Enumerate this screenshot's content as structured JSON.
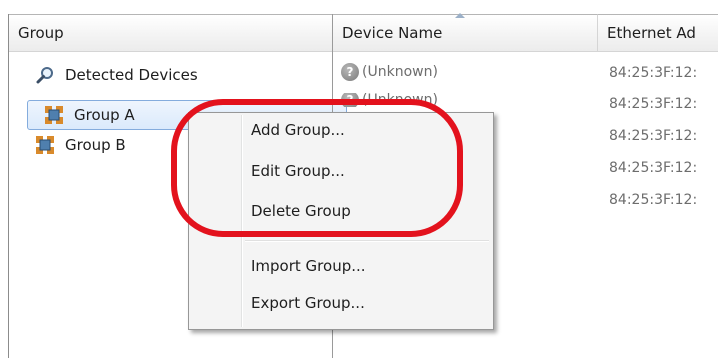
{
  "left_pane": {
    "header": "Group",
    "items": [
      {
        "label": "Detected Devices",
        "icon": "magnifier-icon"
      },
      {
        "label": "Group A",
        "icon": "group-icon",
        "selected": true
      },
      {
        "label": "Group B",
        "icon": "group-icon"
      }
    ]
  },
  "right_pane": {
    "columns": [
      "Device Name",
      "Ethernet Ad"
    ],
    "rows": [
      {
        "name": "(Unknown)",
        "ethernet": "84:25:3F:12:"
      },
      {
        "name": "(Unknown)",
        "ethernet": "84:25:3F:12:"
      },
      {
        "name": "",
        "ethernet": "84:25:3F:12:"
      },
      {
        "name": "",
        "ethernet": "84:25:3F:12:"
      },
      {
        "name": "",
        "ethernet": "84:25:3F:12:"
      }
    ]
  },
  "context_menu": {
    "items": [
      "Add Group...",
      "Edit Group...",
      "Delete Group",
      "Import Group...",
      "Export Group..."
    ]
  },
  "colors": {
    "highlight": "#e3121d",
    "selection": "#dbeafc"
  }
}
